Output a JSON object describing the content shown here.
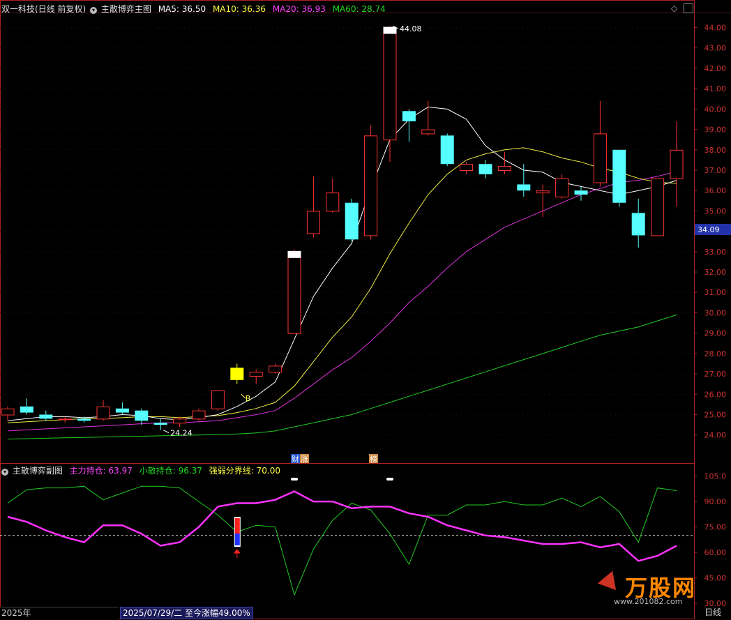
{
  "header": {
    "stock_name": "双一科技",
    "period_mode": "(日线 前复权)",
    "indicator_name": "主散博弈主图",
    "ma5": {
      "label": "MA5: 36.50",
      "color": "#ffffff"
    },
    "ma10": {
      "label": "MA10: 36.36",
      "color": "#ffff44"
    },
    "ma20": {
      "label": "MA20: 36.93",
      "color": "#ff44ff"
    },
    "ma60": {
      "label": "MA60: 28.74",
      "color": "#22dd22"
    }
  },
  "sub_header": {
    "indicator_name": "主散博弈副图",
    "main_hold": {
      "label": "主力持仓: 63.97",
      "color": "#ff44ff"
    },
    "retail_hold": {
      "label": "小散持仓: 96.37",
      "color": "#22dd22"
    },
    "threshold": {
      "label": "强弱分界线: 70.00",
      "color": "#ffff44"
    }
  },
  "chart_data": {
    "type": "candlestick",
    "main_axis": {
      "ticks": [
        "44.00",
        "43.00",
        "42.00",
        "41.00",
        "40.00",
        "39.00",
        "38.00",
        "37.00",
        "36.00",
        "35.00",
        "34.00",
        "33.00",
        "32.00",
        "31.00",
        "30.00",
        "29.00",
        "28.00",
        "27.00",
        "26.00",
        "25.00",
        "24.00"
      ],
      "range": [
        23.1,
        44.6
      ],
      "current_price": "34.09"
    },
    "sub_axis": {
      "ticks": [
        "105.0",
        "90.00",
        "75.00",
        "60.00",
        "45.00",
        "30.00"
      ],
      "range": [
        28,
        111
      ]
    },
    "candles": [
      {
        "o": 25.0,
        "h": 25.4,
        "l": 24.7,
        "c": 25.3
      },
      {
        "o": 25.4,
        "h": 25.8,
        "l": 25.0,
        "c": 25.1
      },
      {
        "o": 25.0,
        "h": 25.2,
        "l": 24.7,
        "c": 24.8
      },
      {
        "o": 24.8,
        "h": 24.9,
        "l": 24.6,
        "c": 24.8
      },
      {
        "o": 24.8,
        "h": 24.9,
        "l": 24.6,
        "c": 24.7
      },
      {
        "o": 24.8,
        "h": 25.7,
        "l": 24.7,
        "c": 25.4
      },
      {
        "o": 25.3,
        "h": 25.6,
        "l": 25.0,
        "c": 25.1
      },
      {
        "o": 25.2,
        "h": 25.3,
        "l": 24.5,
        "c": 24.7
      },
      {
        "o": 24.6,
        "h": 24.8,
        "l": 24.24,
        "c": 24.5
      },
      {
        "o": 24.6,
        "h": 24.9,
        "l": 24.4,
        "c": 24.8
      },
      {
        "o": 24.8,
        "h": 25.3,
        "l": 24.7,
        "c": 25.2
      },
      {
        "o": 25.3,
        "h": 26.2,
        "l": 25.2,
        "c": 26.2
      },
      {
        "o": 26.7,
        "h": 27.5,
        "l": 26.5,
        "c": 27.3,
        "color": "#ffff00"
      },
      {
        "o": 26.9,
        "h": 27.2,
        "l": 26.5,
        "c": 27.1
      },
      {
        "o": 27.1,
        "h": 27.5,
        "l": 27.0,
        "c": 27.4
      },
      {
        "o": 29.0,
        "h": 33.1,
        "l": 29.0,
        "c": 33.0,
        "limit": true
      },
      {
        "o": 33.9,
        "h": 36.7,
        "l": 33.7,
        "c": 35.0
      },
      {
        "o": 35.0,
        "h": 36.6,
        "l": 34.9,
        "c": 35.9
      },
      {
        "o": 35.4,
        "h": 35.6,
        "l": 33.5,
        "c": 33.6
      },
      {
        "o": 33.8,
        "h": 39.2,
        "l": 33.6,
        "c": 38.7
      },
      {
        "o": 38.5,
        "h": 44.08,
        "l": 37.4,
        "c": 44.0,
        "limit": true
      },
      {
        "o": 39.9,
        "h": 40.0,
        "l": 38.4,
        "c": 39.4
      },
      {
        "o": 38.8,
        "h": 40.4,
        "l": 38.7,
        "c": 39.0
      },
      {
        "o": 38.7,
        "h": 38.8,
        "l": 37.2,
        "c": 37.3
      },
      {
        "o": 37.0,
        "h": 37.4,
        "l": 36.8,
        "c": 37.3
      },
      {
        "o": 37.3,
        "h": 37.5,
        "l": 36.6,
        "c": 36.8
      },
      {
        "o": 37.0,
        "h": 37.9,
        "l": 36.8,
        "c": 37.2
      },
      {
        "o": 36.3,
        "h": 37.3,
        "l": 35.7,
        "c": 36.0
      },
      {
        "o": 35.9,
        "h": 36.3,
        "l": 34.7,
        "c": 36.0
      },
      {
        "o": 35.7,
        "h": 36.8,
        "l": 35.6,
        "c": 36.6
      },
      {
        "o": 36.0,
        "h": 36.2,
        "l": 35.5,
        "c": 35.8
      },
      {
        "o": 36.4,
        "h": 40.4,
        "l": 36.2,
        "c": 38.8
      },
      {
        "o": 38.0,
        "h": 38.0,
        "l": 35.2,
        "c": 35.4
      },
      {
        "o": 34.9,
        "h": 35.6,
        "l": 33.2,
        "c": 33.8
      },
      {
        "o": 33.8,
        "h": 36.2,
        "l": 33.8,
        "c": 36.6
      },
      {
        "o": 36.6,
        "h": 39.4,
        "l": 35.2,
        "c": 38.0
      }
    ],
    "ma5": [
      24.7,
      24.8,
      24.9,
      24.9,
      24.85,
      24.9,
      25.0,
      24.95,
      24.8,
      24.75,
      24.85,
      25.0,
      25.4,
      25.9,
      26.6,
      28.7,
      30.8,
      32.2,
      33.4,
      36.1,
      38.5,
      39.5,
      40.1,
      40.0,
      39.5,
      38.2,
      37.5,
      37.0,
      36.9,
      36.4,
      36.2,
      36.0,
      35.8,
      36.0,
      36.2,
      36.5
    ],
    "ma10": [
      24.6,
      24.65,
      24.7,
      24.75,
      24.8,
      24.8,
      24.85,
      24.9,
      24.9,
      24.85,
      24.9,
      24.95,
      25.1,
      25.3,
      25.6,
      26.4,
      27.6,
      28.8,
      29.8,
      31.2,
      32.9,
      34.4,
      35.8,
      36.8,
      37.5,
      37.8,
      38.0,
      38.1,
      37.9,
      37.6,
      37.4,
      37.1,
      36.9,
      36.6,
      36.4,
      36.36
    ],
    "ma20": [
      24.2,
      24.25,
      24.3,
      24.35,
      24.4,
      24.45,
      24.5,
      24.55,
      24.6,
      24.6,
      24.65,
      24.7,
      24.85,
      25.0,
      25.2,
      25.8,
      26.5,
      27.2,
      27.8,
      28.6,
      29.5,
      30.5,
      31.3,
      32.2,
      33.0,
      33.6,
      34.2,
      34.6,
      35.0,
      35.4,
      35.8,
      36.1,
      36.4,
      36.5,
      36.7,
      36.93
    ],
    "ma60": [
      23.8,
      23.82,
      23.84,
      23.86,
      23.88,
      23.9,
      23.92,
      23.94,
      23.96,
      23.98,
      24.0,
      24.02,
      24.05,
      24.1,
      24.2,
      24.4,
      24.6,
      24.8,
      25.0,
      25.3,
      25.6,
      25.9,
      26.2,
      26.5,
      26.8,
      27.1,
      27.4,
      27.7,
      28.0,
      28.3,
      28.6,
      28.9,
      29.1,
      29.3,
      29.6,
      29.9
    ],
    "main_hold": [
      81,
      78,
      73,
      69,
      66,
      76,
      76,
      71,
      64,
      66,
      75,
      87,
      89,
      89,
      91,
      96,
      90,
      90,
      86,
      87,
      87,
      83,
      81,
      76,
      73,
      70,
      69,
      67,
      65,
      65,
      66,
      63,
      65,
      55,
      58,
      63.97
    ],
    "retail_hold": [
      89,
      97,
      98,
      98,
      99,
      91,
      95,
      99,
      99,
      98,
      90,
      82,
      72,
      76,
      75,
      35,
      62,
      79,
      89,
      85,
      71,
      53,
      82,
      82,
      88,
      88,
      90,
      88,
      88,
      92,
      87,
      93,
      84,
      66,
      98,
      96.37
    ],
    "threshold": 70,
    "annotations": {
      "high_label": "44.08",
      "low_label": "24.24",
      "signal_label": "B"
    },
    "event_badges": [
      {
        "label": "财",
        "bg": "#2255cc",
        "fg": "#ffffff"
      },
      {
        "label": "涨",
        "bg": "#cc8844",
        "fg": "#ffffff"
      },
      {
        "label": "榜",
        "bg": "#cc8844",
        "fg": "#ffffff"
      }
    ]
  },
  "footer": {
    "year_label": "2025年",
    "status_text": "2025/07/29/二  至今涨幅49.00%",
    "period_label": "日线"
  },
  "watermark": {
    "brand_text": "万股网",
    "site_text": "www.201082.com"
  }
}
